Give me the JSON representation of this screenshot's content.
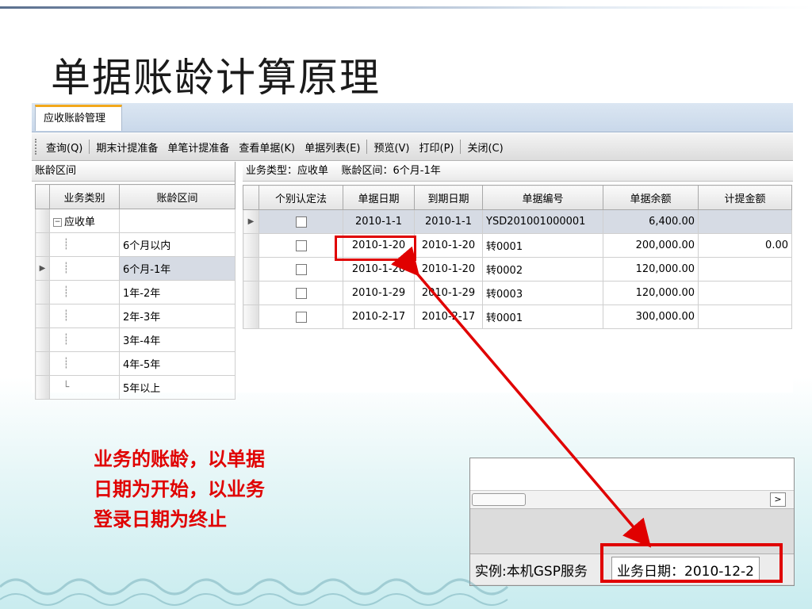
{
  "slide": {
    "title": "单据账龄计算原理"
  },
  "window": {
    "tab_label": "应收账龄管理",
    "toolbar": [
      "查询(Q)",
      "期末计提准备",
      "单笔计提准备",
      "查看单据(K)",
      "单据列表(E)",
      "预览(V)",
      "打印(P)",
      "关闭(C)"
    ],
    "left": {
      "header": "账龄区间",
      "columns": [
        "业务类别",
        "账龄区间"
      ],
      "root": "应收单",
      "intervals": [
        "6个月以内",
        "6个月-1年",
        "1年-2年",
        "2年-3年",
        "3年-4年",
        "4年-5年",
        "5年以上"
      ],
      "selected_index": 1
    },
    "right": {
      "header": "业务类型：应收单    账龄区间：6个月-1年",
      "columns": [
        "个别认定法",
        "单据日期",
        "到期日期",
        "单据编号",
        "单据余额",
        "计提金额"
      ],
      "rows": [
        {
          "doc_date": "2010-1-1",
          "due_date": "2010-1-1",
          "doc_no": "YSD201001000001",
          "balance": "6,400.00",
          "provision": ""
        },
        {
          "doc_date": "2010-1-20",
          "due_date": "2010-1-20",
          "doc_no": "转0001",
          "balance": "200,000.00",
          "provision": "0.00"
        },
        {
          "doc_date": "2010-1-20",
          "due_date": "2010-1-20",
          "doc_no": "转0002",
          "balance": "120,000.00",
          "provision": ""
        },
        {
          "doc_date": "2010-1-29",
          "due_date": "2010-1-29",
          "doc_no": "转0003",
          "balance": "120,000.00",
          "provision": ""
        },
        {
          "doc_date": "2010-2-17",
          "due_date": "2010-2-17",
          "doc_no": "转0001",
          "balance": "300,000.00",
          "provision": ""
        }
      ]
    }
  },
  "inset": {
    "status_instance": "实例:本机GSP服务",
    "status_date": "业务日期：2010-12-2"
  },
  "annotation": {
    "line1": "业务的账龄，以单据",
    "line2": "日期为开始，以业务",
    "line3": "登录日期为终止"
  },
  "colors": {
    "highlight": "#e00000",
    "tab_accent": "#f2a81d"
  }
}
